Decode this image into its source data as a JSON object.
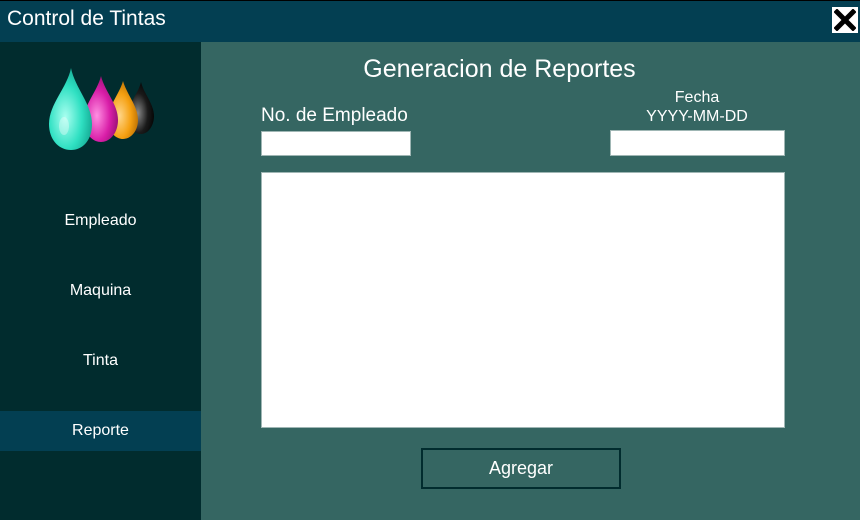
{
  "window": {
    "title": "Control de Tintas",
    "close_icon": "close-x-icon"
  },
  "sidebar": {
    "logo_icon": "ink-drops-logo",
    "logo_colors": [
      "#2fe0c2",
      "#d91ea8",
      "#f5a011",
      "#1a1a1a"
    ],
    "items": [
      {
        "label": "Empleado",
        "active": false
      },
      {
        "label": "Maquina",
        "active": false
      },
      {
        "label": "Tinta",
        "active": false
      },
      {
        "label": "Reporte",
        "active": true
      }
    ]
  },
  "main": {
    "heading": "Generacion de Reportes",
    "employee": {
      "label": "No. de Empleado",
      "value": ""
    },
    "date": {
      "label": "Fecha",
      "format_hint": "YYYY-MM-DD",
      "value": ""
    },
    "report_text": "",
    "add_button_label": "Agregar"
  },
  "colors": {
    "titlebar": "#033f52",
    "sidebar": "#012c2e",
    "main_background": "#356662",
    "active_item": "#033f52"
  }
}
